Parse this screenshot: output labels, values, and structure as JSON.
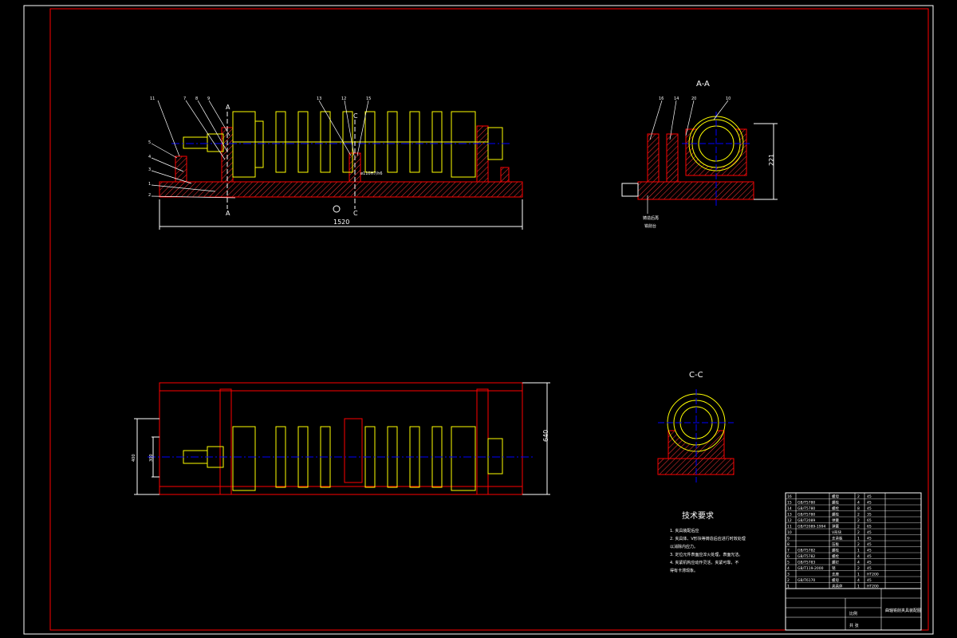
{
  "drawing": {
    "front_view": {
      "length_dimension": "1520",
      "section_mark_a_top": "A",
      "section_mark_a_bottom": "A",
      "section_mark_c_top": "C",
      "section_mark_c_bottom": "C",
      "fit_note": "ø110H7/h6",
      "balloons": [
        "11",
        "7",
        "8",
        "9",
        "13",
        "12",
        "15",
        "5",
        "4",
        "3",
        "1",
        "2"
      ]
    },
    "section_a": {
      "label": "A-A",
      "height_dimension": "221",
      "balloons": [
        "16",
        "14",
        "20",
        "10"
      ],
      "note_line1": "铸造后再",
      "note_line2": "铣削台"
    },
    "top_view": {
      "width_dimension": "640",
      "inner_dimension_1": "400",
      "inner_dimension_2": "300"
    },
    "section_c": {
      "label": "C-C"
    },
    "technical_requirements": {
      "heading": "技术要求",
      "items": [
        "1. 夹具装配后应",
        "2. 夹具体、V形块等铸造后应进行时效处理",
        "   以消除内应力。",
        "3. 定位元件表面应淬火处理，表面光洁。",
        "4. 夹紧机构应动作灵活，夹紧可靠，不",
        "   得有卡滞现象。"
      ]
    },
    "bom": {
      "rows": [
        {
          "no": "16",
          "code": "",
          "name": "螺母",
          "qty": "2",
          "material": "45"
        },
        {
          "no": "15",
          "code": "GB/T5780",
          "name": "螺栓",
          "qty": "4",
          "material": "45"
        },
        {
          "no": "14",
          "code": "GB/T5780",
          "name": "螺栓",
          "qty": "8",
          "material": "45"
        },
        {
          "no": "13",
          "code": "GB/T5780",
          "name": "螺栓",
          "qty": "2",
          "material": "35"
        },
        {
          "no": "12",
          "code": "GB/T2089",
          "name": "弹簧",
          "qty": "2",
          "material": "65"
        },
        {
          "no": "11",
          "code": "GB/T2089-1994",
          "name": "弹簧",
          "qty": "2",
          "material": "65"
        },
        {
          "no": "10",
          "code": "",
          "name": "V形块",
          "qty": "2",
          "material": "45"
        },
        {
          "no": "9",
          "code": "",
          "name": "支承板",
          "qty": "1",
          "material": "45"
        },
        {
          "no": "8",
          "code": "",
          "name": "压板",
          "qty": "2",
          "material": "45"
        },
        {
          "no": "7",
          "code": "GB/T5782",
          "name": "螺栓",
          "qty": "1",
          "material": "45"
        },
        {
          "no": "6",
          "code": "GB/T5782",
          "name": "螺栓",
          "qty": "4",
          "material": "45"
        },
        {
          "no": "5",
          "code": "GB/T5783",
          "name": "螺钉",
          "qty": "4",
          "material": "45"
        },
        {
          "no": "4",
          "code": "GB/T119-2000",
          "name": "销",
          "qty": "2",
          "material": "45"
        },
        {
          "no": "3",
          "code": "",
          "name": "支座",
          "qty": "1",
          "material": "HT200"
        },
        {
          "no": "2",
          "code": "GB/T6170",
          "name": "螺母",
          "qty": "4",
          "material": "45"
        },
        {
          "no": "1",
          "code": "",
          "name": "夹具体",
          "qty": "1",
          "material": "HT200"
        }
      ],
      "header": {
        "no": "序号",
        "code": "代号",
        "name": "名称",
        "qty": "数量",
        "material": "材料",
        "weight": "重量"
      }
    },
    "title_block": {
      "drawing_title": "曲轴铣削夹具装配图",
      "scale_label": "比例",
      "sheet_label": "共 张"
    }
  },
  "colors": {
    "background": "#000000",
    "frame": "#ff0000",
    "part": "#ffff00",
    "fixture": "#ff0000",
    "centerline": "#0000ff",
    "dimension": "#ffffff",
    "hatch": "#ff4444"
  }
}
